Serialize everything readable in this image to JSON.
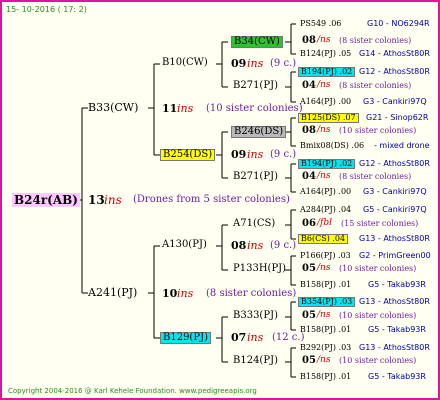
{
  "header_date": "15- 10-2016 ( 17: 2)",
  "footer": "Copyright 2004-2016 @ Karl Kehele Foundation.   www.pedigreeapis.org",
  "colors": {
    "border": "#e0149c",
    "green": "#2ec22e",
    "yellow": "#ffff00",
    "cyan": "#00e5ee",
    "gray": "#b8b8b8",
    "pink": "#ffc8ff",
    "red": "#cc0000",
    "blue": "#0000aa",
    "purple": "#6a1fa0"
  },
  "root": {
    "label": "B24r(AB)",
    "num": "13",
    "ins": "ins",
    "note": "(Drones from 5 sister colonies)"
  },
  "g1": [
    {
      "label": "B33(CW)",
      "num": "11",
      "ins": "ins",
      "note": "(10 sister colonies)"
    },
    {
      "label": "A241(PJ)",
      "num": "10",
      "ins": "ins",
      "note": "(8 sister colonies)"
    }
  ],
  "g2": [
    {
      "label": "B10(CW)",
      "num": "09",
      "ins": "ins",
      "note": "(9 c.)"
    },
    {
      "label": "B254(DS)",
      "num": "09",
      "ins": "ins",
      "note": "(9 c.)"
    },
    {
      "label": "A130(PJ)",
      "num": "08",
      "ins": "ins",
      "note": "(9 c.)"
    },
    {
      "label": "B129(PJ)",
      "num": "07",
      "ins": "ins",
      "note": "(12 c.)"
    }
  ],
  "g3": [
    {
      "label": "B34(CW)",
      "num": "08",
      "ins": "/ns",
      "note": "(8 sister colonies)"
    },
    {
      "label": "B271(PJ)",
      "num": "04",
      "ins": "/ns",
      "note": "(8 sister colonies)"
    },
    {
      "label": "B246(DS)",
      "num": "08",
      "ins": "/ns",
      "note": "(10 sister colonies)"
    },
    {
      "label": "B271(PJ)",
      "num": "04",
      "ins": "/ns",
      "note": "(8 sister colonies)"
    },
    {
      "label": "A71(CS)",
      "num": "06",
      "ins": "/fbl",
      "note": "(15 sister colonies)"
    },
    {
      "label": "P133H(PJ)",
      "num": "05",
      "ins": "/ns",
      "note": "(10 sister colonies)"
    },
    {
      "label": "B333(PJ)",
      "num": "05",
      "ins": "/ns",
      "note": "(10 sister colonies)"
    },
    {
      "label": "B124(PJ)",
      "num": "05",
      "ins": "/ns",
      "note": "(10 sister colonies)"
    }
  ],
  "g4": [
    {
      "label": "PS549 .06",
      "tag": "G10 - NO6294R"
    },
    {
      "label": "B124(PJ) .05",
      "tag": "G14 - AthosSt80R"
    },
    {
      "label": "B194(PJ) .02",
      "tag": "G12 - AthosSt80R"
    },
    {
      "label": "A164(PJ) .00",
      "tag": "G3 - Cankiri97Q"
    },
    {
      "label": "B125(DS) .07",
      "tag": "G21 - Sinop62R"
    },
    {
      "label": "Bmix08(DS) .06",
      "tag": "- mixed drone"
    },
    {
      "label": "B194(PJ) .02",
      "tag": "G12 - AthosSt80R"
    },
    {
      "label": "A164(PJ) .00",
      "tag": "G3 - Cankiri97Q"
    },
    {
      "label": "A284(PJ) .04",
      "tag": "G5 - Cankiri97Q"
    },
    {
      "label": "B6(CS) .04",
      "tag": "G13 - AthosSt80R"
    },
    {
      "label": "P166(PJ) .03",
      "tag": "G2 - PrimGreen00"
    },
    {
      "label": "B158(PJ) .01",
      "tag": "G5 - Takab93R"
    },
    {
      "label": "B354(PJ) .03",
      "tag": "G13 - AthosSt80R"
    },
    {
      "label": "B158(PJ) .01",
      "tag": "G5 - Takab93R"
    },
    {
      "label": "B292(PJ) .03",
      "tag": "G13 - AthosSt80R"
    },
    {
      "label": "B158(PJ) .01",
      "tag": "G5 - Takab93R"
    }
  ]
}
